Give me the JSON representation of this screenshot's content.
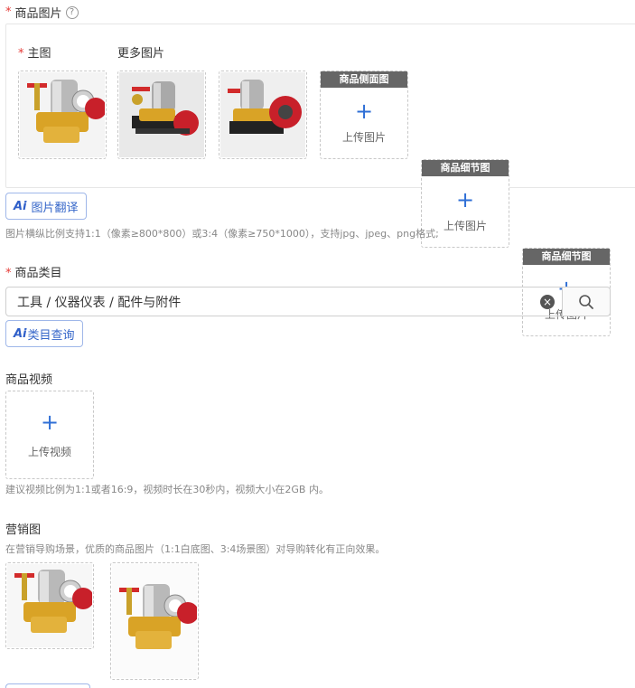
{
  "product_images": {
    "required_mark": "*",
    "title": "商品图片",
    "help_icon": "?",
    "main_label": "主图",
    "more_label": "更多图片",
    "upload_slots": [
      {
        "header": "商品侧面图",
        "plus": "+",
        "text": "上传图片"
      },
      {
        "header": "商品细节图",
        "plus": "+",
        "text": "上传图片"
      },
      {
        "header": "商品细节图",
        "plus": "+",
        "text": "上传图片"
      }
    ],
    "translate_button": {
      "ai": "Ai",
      "label": "图片翻译"
    },
    "hint": "图片横纵比例支持1:1（像素≥800*800）或3:4（像素≥750*1000），支持jpg、jpeg、png格式;"
  },
  "category": {
    "required_mark": "*",
    "title": "商品类目",
    "value": "工具 / 仪器仪表 / 配件与附件",
    "clear_icon": "×",
    "ai_query_button": {
      "ai": "Ai",
      "label": "类目查询"
    }
  },
  "video": {
    "title": "商品视频",
    "plus": "+",
    "upload_text": "上传视频",
    "hint": "建议视频比例为1:1或者16:9，视频时长在30秒内，视频大小在2GB 内。"
  },
  "marketing": {
    "title": "营销图",
    "hint": "在营销导购场景，优质的商品图片（1:1白底图、3:4场景图）对导购转化有正向效果。"
  },
  "colors": {
    "accent": "#2f6fd6",
    "required": "#e53935",
    "slot_header": "#666666"
  }
}
